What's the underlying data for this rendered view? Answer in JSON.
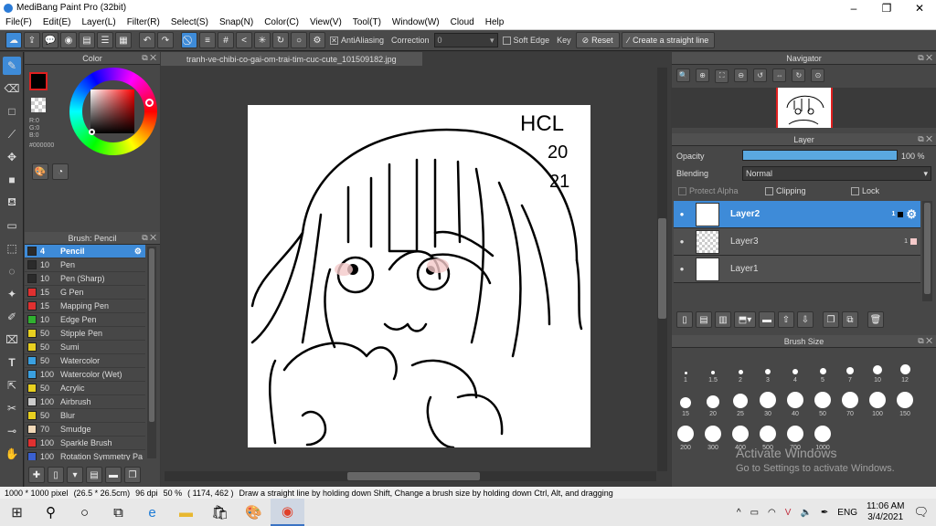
{
  "app": {
    "title": "MediBang Paint Pro (32bit)"
  },
  "menu": [
    "File(F)",
    "Edit(E)",
    "Layer(L)",
    "Filter(R)",
    "Select(S)",
    "Snap(N)",
    "Color(C)",
    "View(V)",
    "Tool(T)",
    "Window(W)",
    "Cloud",
    "Help"
  ],
  "toolbar": {
    "antialias_label": "AntiAliasing",
    "correction_label": "Correction",
    "correction_value": "0",
    "softedge_label": "Soft Edge",
    "key_label": "Key",
    "reset_label": "Reset",
    "straight_line_label": "Create a straight line"
  },
  "color_panel": {
    "title": "Color",
    "r": "R:0",
    "g": "G:0",
    "b": "B:0",
    "hex": "#000000",
    "current_color": "#000000"
  },
  "brush_panel": {
    "title": "Brush: Pencil",
    "brushes": [
      {
        "size": "4",
        "name": "Pencil",
        "color": "#2b2b2b",
        "selected": true
      },
      {
        "size": "10",
        "name": "Pen",
        "color": "#2b2b2b"
      },
      {
        "size": "10",
        "name": "Pen (Sharp)",
        "color": "#2b2b2b"
      },
      {
        "size": "15",
        "name": "G Pen",
        "color": "#e03030"
      },
      {
        "size": "15",
        "name": "Mapping Pen",
        "color": "#e03030"
      },
      {
        "size": "10",
        "name": "Edge Pen",
        "color": "#30b030"
      },
      {
        "size": "50",
        "name": "Stipple Pen",
        "color": "#e8d020"
      },
      {
        "size": "50",
        "name": "Sumi",
        "color": "#e8d020"
      },
      {
        "size": "50",
        "name": "Watercolor",
        "color": "#3aa0e0"
      },
      {
        "size": "100",
        "name": "Watercolor (Wet)",
        "color": "#3aa0e0"
      },
      {
        "size": "50",
        "name": "Acrylic",
        "color": "#e8d020"
      },
      {
        "size": "100",
        "name": "Airbrush",
        "color": "#cccccc"
      },
      {
        "size": "50",
        "name": "Blur",
        "color": "#e8d020"
      },
      {
        "size": "70",
        "name": "Smudge",
        "color": "#f0d8b8"
      },
      {
        "size": "100",
        "name": "Sparkle Brush",
        "color": "#e03030"
      },
      {
        "size": "100",
        "name": "Rotation Symmetry Pa",
        "color": "#3a60d0"
      }
    ]
  },
  "document": {
    "tab": "tranh-ve-chibi-co-gai-om-trai-tim-cuc-cute_101509182.jpg"
  },
  "navigator": {
    "title": "Navigator"
  },
  "layer_panel": {
    "title": "Layer",
    "opacity_label": "Opacity",
    "opacity_value": "100 %",
    "opacity": 1.0,
    "blending_label": "Blending",
    "blending_value": "Normal",
    "protect_alpha_label": "Protect Alpha",
    "clipping_label": "Clipping",
    "lock_label": "Lock",
    "layers": [
      {
        "name": "Layer2",
        "selected": true,
        "count": "1"
      },
      {
        "name": "Layer3",
        "count": "1"
      },
      {
        "name": "Layer1"
      }
    ]
  },
  "brush_size_panel": {
    "title": "Brush Size",
    "sizes": [
      "1",
      "1.5",
      "2",
      "3",
      "4",
      "5",
      "7",
      "10",
      "12",
      "15",
      "20",
      "25",
      "30",
      "40",
      "50",
      "70",
      "100",
      "150",
      "200",
      "300",
      "400",
      "500",
      "700",
      "1000"
    ]
  },
  "statusbar": {
    "canvas_size": "1000 * 1000 pixel",
    "physical_size": "(26.5 * 26.5cm)",
    "dpi": "96 dpi",
    "zoom": "50 %",
    "cursor": "( 1174, 462 )",
    "hint": "Draw a straight line by holding down Shift, Change a brush size by holding down Ctrl, Alt, and dragging"
  },
  "watermark": {
    "line1": "Activate Windows",
    "line2": "Go to Settings to activate Windows."
  },
  "canvas_text": {
    "line1": "HCL",
    "line2": "20",
    "line3": "21"
  },
  "taskbar": {
    "lang": "ENG",
    "time": "11:06 AM",
    "date": "3/4/2021"
  }
}
